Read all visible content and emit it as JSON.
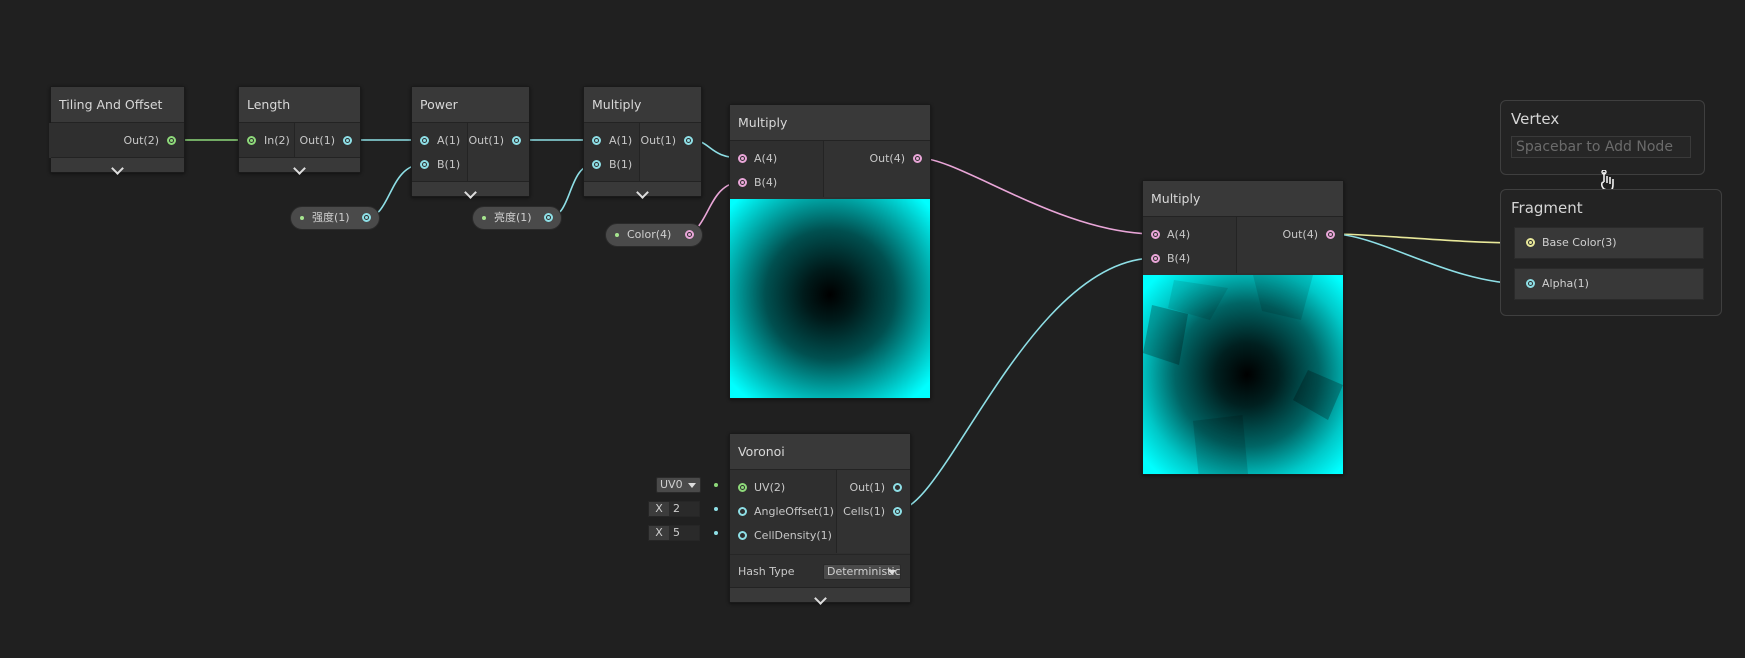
{
  "colors": {
    "background": "#202020",
    "wire_float": "#8edfe6",
    "wire_vec2": "#8ed97a",
    "wire_vec4": "#e9a6d8",
    "wire_vec3": "#e8e89a",
    "preview": "#00ffff"
  },
  "nodes": {
    "tiling": {
      "title": "Tiling And Offset",
      "out": "Out(2)"
    },
    "length": {
      "title": "Length",
      "in": "In(2)",
      "out": "Out(1)"
    },
    "power": {
      "title": "Power",
      "in_a": "A(1)",
      "in_b": "B(1)",
      "out": "Out(1)"
    },
    "multiply1": {
      "title": "Multiply",
      "in_a": "A(1)",
      "in_b": "B(1)",
      "out": "Out(1)"
    },
    "multiply2": {
      "title": "Multiply",
      "in_a": "A(4)",
      "in_b": "B(4)",
      "out": "Out(4)"
    },
    "multiply3": {
      "title": "Multiply",
      "in_a": "A(4)",
      "in_b": "B(4)",
      "out": "Out(4)"
    },
    "voronoi": {
      "title": "Voronoi",
      "in_uv": "UV(2)",
      "in_angle": "AngleOffset(1)",
      "in_density": "CellDensity(1)",
      "out_out": "Out(1)",
      "out_cells": "Cells(1)",
      "hash_label": "Hash Type",
      "hash_value": "Deterministic",
      "uv_value": "UV0",
      "angle_axis": "X",
      "angle_value": "2",
      "density_axis": "X",
      "density_value": "5"
    }
  },
  "properties": {
    "intensity": "强度(1)",
    "brightness": "亮度(1)",
    "color": "Color(4)"
  },
  "master": {
    "vertex_title": "Vertex",
    "search_placeholder": "Spacebar to Add Node",
    "fragment_title": "Fragment",
    "base_color": "Base Color(3)",
    "alpha": "Alpha(1)"
  }
}
